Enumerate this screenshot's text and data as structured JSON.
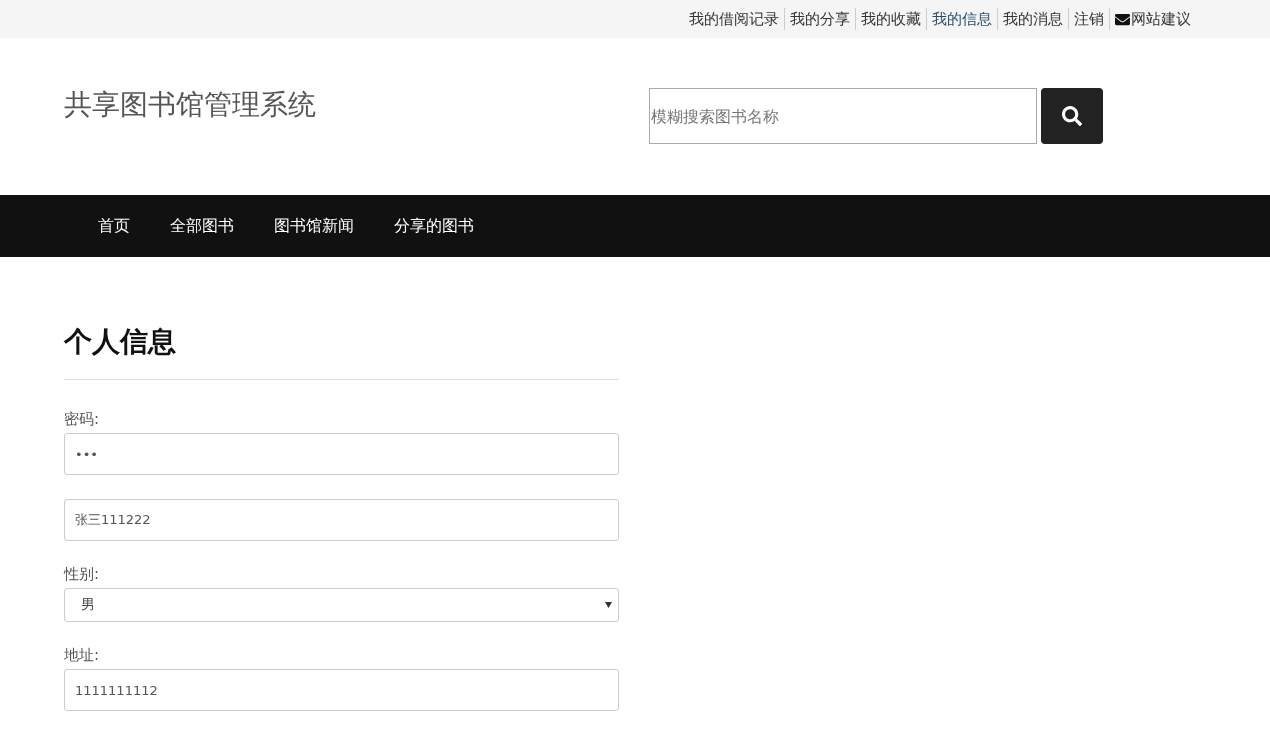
{
  "top_links": [
    {
      "label": "我的借阅记录",
      "selected": false
    },
    {
      "label": "我的分享",
      "selected": false
    },
    {
      "label": "我的收藏",
      "selected": false
    },
    {
      "label": "我的信息",
      "selected": true
    },
    {
      "label": "我的消息",
      "selected": false
    },
    {
      "label": "注销",
      "selected": false
    },
    {
      "label": "网站建议",
      "selected": false,
      "kind": "mail"
    }
  ],
  "site_title": "共享图书馆管理系统",
  "search": {
    "placeholder": "模糊搜索图书名称"
  },
  "nav": [
    "首页",
    "全部图书",
    "图书馆新闻",
    "分享的图书"
  ],
  "heading": "个人信息",
  "fields": [
    {
      "kind": "text",
      "label": "密码:",
      "value": "•••"
    },
    {
      "kind": "text",
      "value": "张三111222"
    },
    {
      "kind": "select",
      "label": "性别:",
      "value": "男"
    },
    {
      "kind": "text",
      "label": "地址:",
      "value": "1111111112"
    }
  ]
}
